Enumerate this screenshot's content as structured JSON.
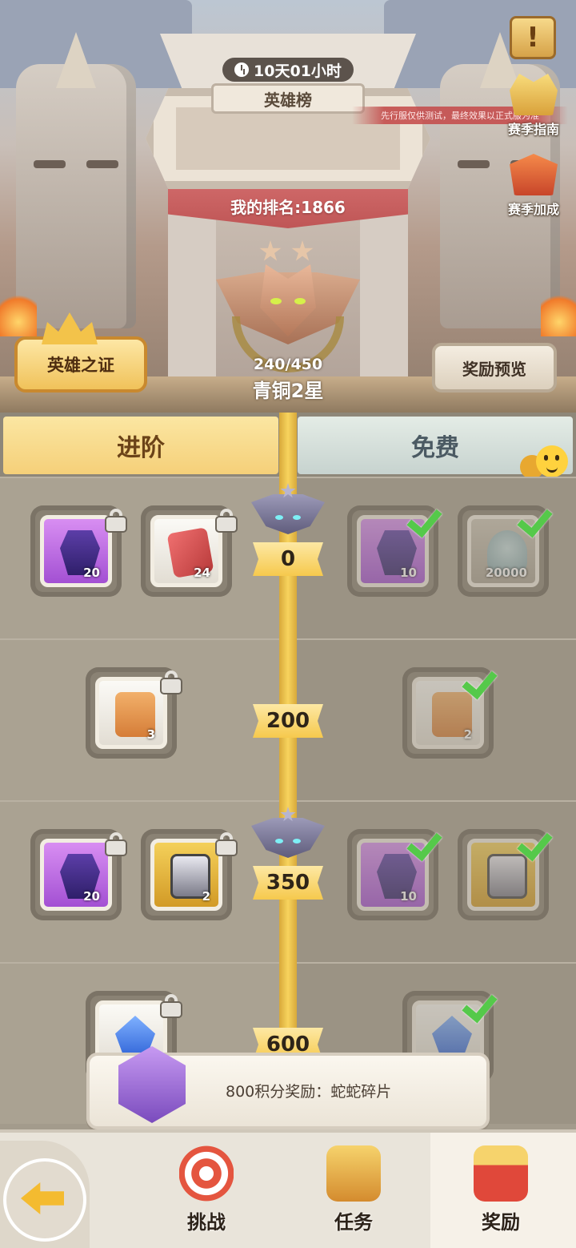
{
  "header": {
    "timer": "10天01小时",
    "board_title": "英雄榜",
    "notice": "先行服仅供测试，最终效果以正式服为准",
    "my_rank": "我的排名:1866",
    "progress": "240/450",
    "progress_value": 0.533,
    "rank_name": "青铜2星",
    "hero_proof_btn": "英雄之证",
    "reward_preview_btn": "奖励预览"
  },
  "side_buttons": {
    "notice_symbol": "!",
    "season_guide": "赛季指南",
    "season_bonus": "赛季加成"
  },
  "tabs": {
    "advanced": "进阶",
    "free": "免费"
  },
  "chat": {
    "label": "聊天"
  },
  "tiers": [
    {
      "points": "0",
      "advanced": [
        {
          "icon": "purple-gem-icon",
          "qty": "20"
        },
        {
          "icon": "red-ticket-icon",
          "qty": "24"
        }
      ],
      "free": [
        {
          "icon": "purple-gem-icon",
          "qty": "10"
        },
        {
          "icon": "shell-coin-icon",
          "qty": "20000"
        }
      ]
    },
    {
      "points": "200",
      "advanced": [
        {
          "icon": "scroll-icon",
          "qty": "3"
        }
      ],
      "free": [
        {
          "icon": "scroll-icon",
          "qty": "2"
        }
      ]
    },
    {
      "points": "350",
      "advanced": [
        {
          "icon": "purple-gem-icon",
          "qty": "20"
        },
        {
          "icon": "treasure-chest-icon",
          "qty": "2"
        }
      ],
      "free": [
        {
          "icon": "purple-gem-icon",
          "qty": "10"
        },
        {
          "icon": "treasure-chest-icon",
          "qty": ""
        }
      ]
    },
    {
      "points": "600",
      "advanced": [
        {
          "icon": "blue-crystal-icon",
          "qty": ""
        }
      ],
      "free": [
        {
          "icon": "blue-crystal-icon",
          "qty": ""
        }
      ]
    }
  ],
  "tooltip": {
    "text": "800积分奖励：蛇蛇碎片"
  },
  "nav": {
    "challenge": "挑战",
    "tasks": "任务",
    "rewards": "奖励"
  },
  "colors": {
    "accent_gold": "#f6c94d",
    "check_green": "#55c94a",
    "rank_red": "#c85a5a"
  }
}
